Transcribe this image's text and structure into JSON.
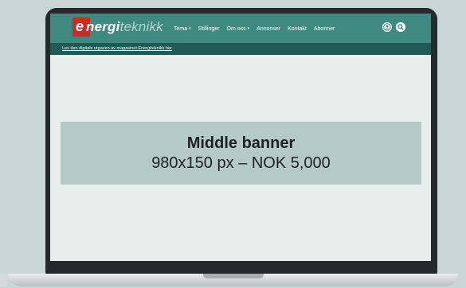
{
  "logo": {
    "letter": "e",
    "bold": "nergi",
    "light": "teknikk"
  },
  "nav": {
    "items": [
      {
        "label": "Tema",
        "caret": "▾"
      },
      {
        "label": "Stillinger",
        "caret": ""
      },
      {
        "label": "Om oss",
        "caret": "▾"
      },
      {
        "label": "Annonser",
        "caret": ""
      },
      {
        "label": "Kontakt",
        "caret": ""
      },
      {
        "label": "Abonner",
        "caret": ""
      }
    ],
    "icons": [
      "user-icon",
      "search-icon"
    ]
  },
  "subbar": {
    "link": "Les den digitale utgaven av magasinet Energiteknikk her"
  },
  "banner": {
    "title": "Middle banner",
    "subtitle": "980x150 px – NOK 5,000"
  },
  "colors": {
    "background": "#c9d6d3",
    "navbar": "#3f8a80",
    "subbar": "#1f5a55",
    "banner": "#b5cac5",
    "logo_red": "#cc2a25"
  }
}
